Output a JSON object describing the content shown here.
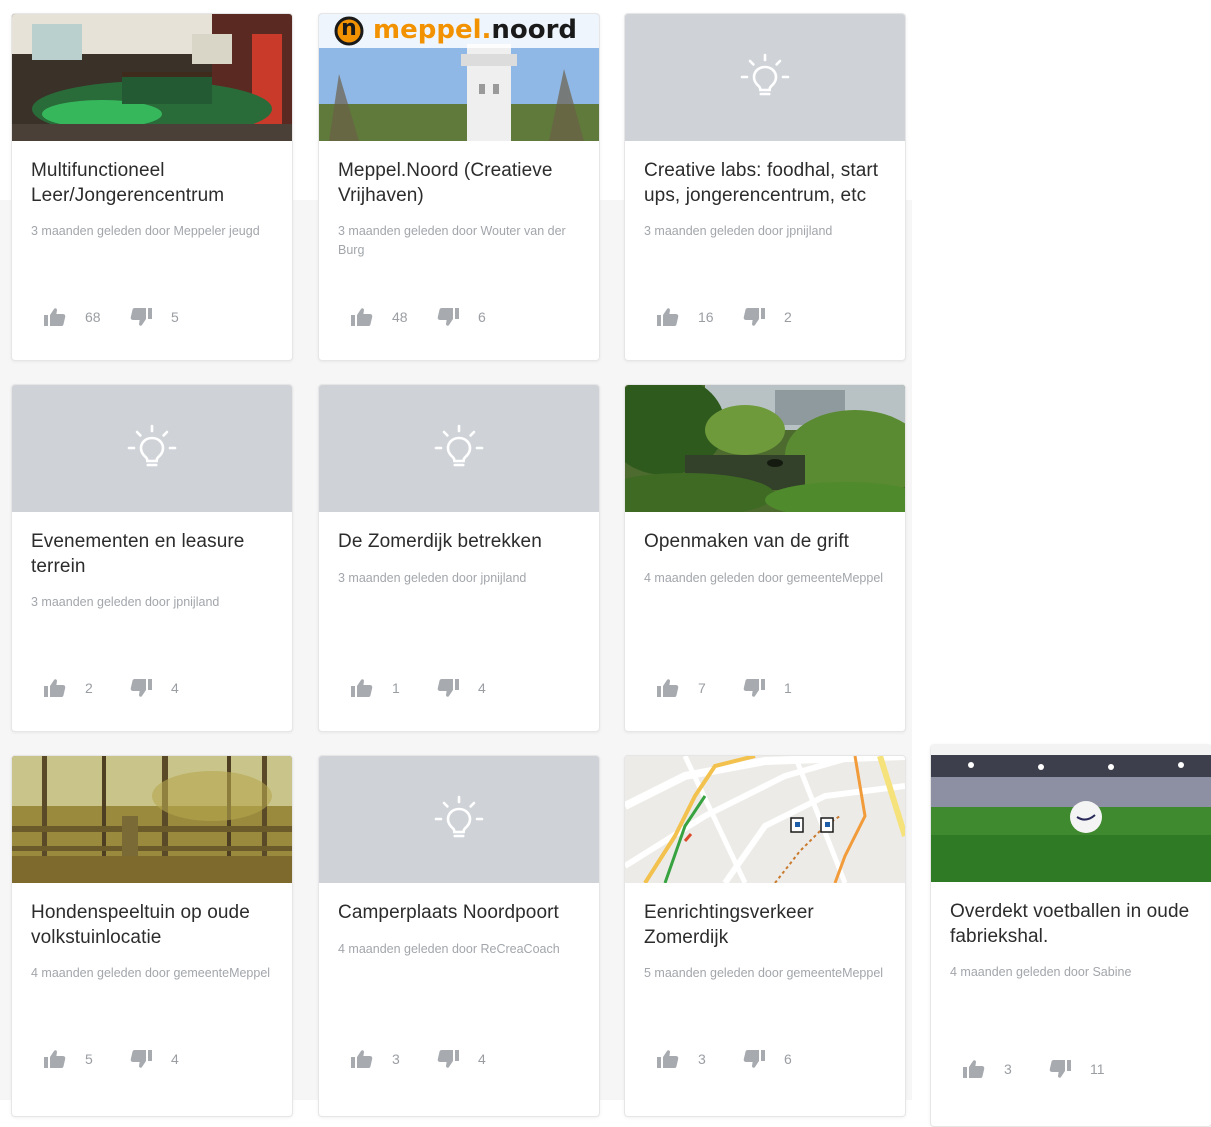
{
  "cards": [
    {
      "title": "Multifunctioneel Leer/Jongerencentrum",
      "meta": "3 maanden geleden door Meppeler jeugd",
      "up": "68",
      "down": "5",
      "thumb": "photo-game-room"
    },
    {
      "title": "Meppel.Noord (Creatieve Vrijhaven)",
      "meta": "3 maanden geleden door Wouter van der Burg",
      "up": "48",
      "down": "6",
      "thumb": "photo-water-tower",
      "logo": {
        "mark": "n",
        "text_orange": "meppel.",
        "text_dark": "noord"
      }
    },
    {
      "title": "Creative labs: foodhal, start ups, jongerencentrum, etc",
      "meta": "3 maanden geleden door jpnijland",
      "up": "16",
      "down": "2",
      "thumb": "placeholder-bulb"
    },
    {
      "title": "Evenementen en leasure terrein",
      "meta": "3 maanden geleden door jpnijland",
      "up": "2",
      "down": "4",
      "thumb": "placeholder-bulb"
    },
    {
      "title": "De Zomerdijk betrekken",
      "meta": "3 maanden geleden door jpnijland",
      "up": "1",
      "down": "4",
      "thumb": "placeholder-bulb"
    },
    {
      "title": "Openmaken van de grift",
      "meta": "4 maanden geleden door gemeenteMeppel",
      "up": "7",
      "down": "1",
      "thumb": "photo-canal"
    },
    {
      "title": "Hondenspeeltuin op oude volkstuinlocatie",
      "meta": "4 maanden geleden door gemeenteMeppel",
      "up": "5",
      "down": "4",
      "thumb": "photo-woods"
    },
    {
      "title": "Camperplaats Noordpoort",
      "meta": "4 maanden geleden door ReCreaCoach",
      "up": "3",
      "down": "4",
      "thumb": "placeholder-bulb"
    },
    {
      "title": "Eenrichtingsverkeer Zomerdijk",
      "meta": "5 maanden geleden door gemeenteMeppel",
      "up": "3",
      "down": "6",
      "thumb": "map"
    },
    {
      "title": "Overdekt voetballen in oude fabriekshal.",
      "meta": "4 maanden geleden door Sabine",
      "up": "3",
      "down": "11",
      "thumb": "photo-indoor-football"
    }
  ],
  "icons": {
    "upvote": "thumbs-up-icon",
    "downvote": "thumbs-down-icon",
    "placeholder": "lightbulb-icon"
  },
  "colors": {
    "placeholder_bg": "#cfd3d8",
    "icon_grey": "#a7abb0",
    "title": "#2c2c2c",
    "meta": "#a2a6ab",
    "logo_orange": "#f39200"
  }
}
